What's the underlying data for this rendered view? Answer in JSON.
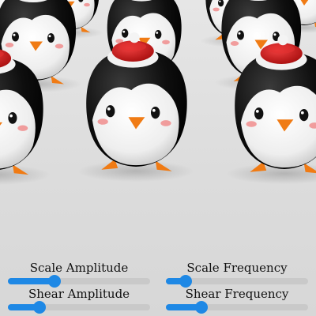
{
  "scene": {
    "subject": "penguin-crowd",
    "colors": {
      "floor": "#dcdcdc",
      "body": "#0e0e0e",
      "belly": "#f2f2f2",
      "beak_feet": "#f07b14",
      "cheek": "#f08080",
      "hat": "#d81d1d",
      "hat_trim": "#f7f7f7"
    }
  },
  "controls": {
    "scale_amplitude": {
      "label": "Scale Amplitude",
      "value": 0.33
    },
    "scale_frequency": {
      "label": "Scale Frequency",
      "value": 0.14
    },
    "shear_amplitude": {
      "label": "Shear Amplitude",
      "value": 0.22
    },
    "shear_frequency": {
      "label": "Shear Frequency",
      "value": 0.25
    },
    "accent_color": "#1e88e5"
  }
}
